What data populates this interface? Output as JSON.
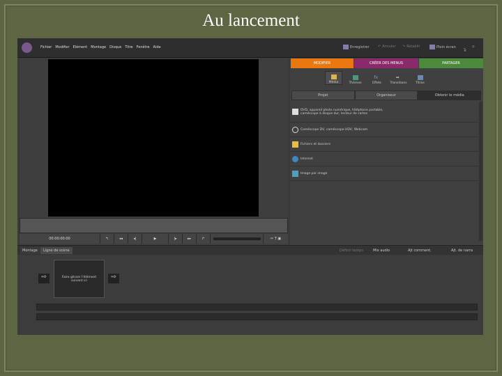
{
  "slide_title": "Au lancement",
  "menu": [
    "Fichier",
    "Modifier",
    "Elément",
    "Montage",
    "Disque",
    "Titre",
    "Fenêtre",
    "Aide"
  ],
  "toolbar": {
    "save": "Enregistrer",
    "undo": "Annuler",
    "redo": "Rétablir",
    "fullscreen": "Plein écran"
  },
  "tabs": [
    "MODIFIER",
    "CRÉER DES MENUS",
    "PARTAGER"
  ],
  "tab_colors": [
    "#e8780f",
    "#8a2a6a",
    "#4a8a3a"
  ],
  "tools": [
    "Média",
    "Thèmes",
    "Effets",
    "Transitions",
    "Titres"
  ],
  "subtabs": [
    "Projet",
    "Organiseur",
    "Obtenir le média"
  ],
  "sources": [
    "DVD, appareil photo numérique, téléphone portable, caméscope à disque dur, lecteur de cartes",
    "Caméscope DV, caméscope HDV, Webcam",
    "Fichiers et dossiers",
    "Internet",
    "Image par image"
  ],
  "timecode": "00:00:00:00",
  "timeline_tabs": [
    "Montage",
    "Ligne de scène"
  ],
  "timeline_actions": [
    "Définir temps",
    "Mix audio",
    "Ajt comment.",
    "Ajt. de narra"
  ],
  "placeholder": "Faire glisser l'élément suivant ici"
}
